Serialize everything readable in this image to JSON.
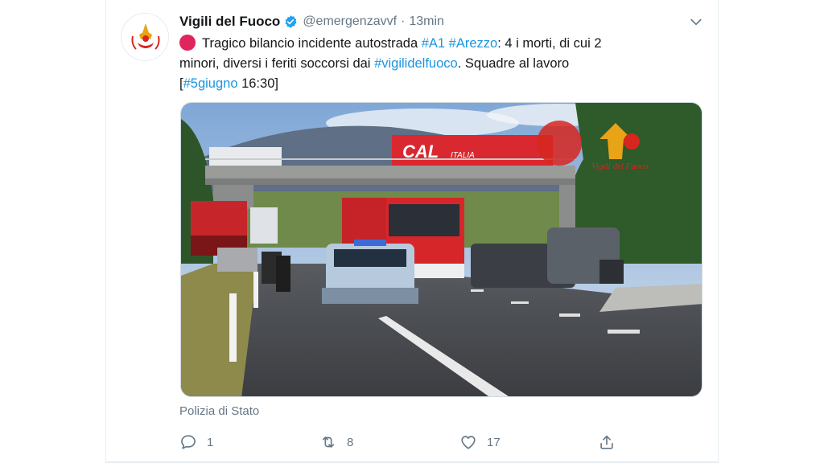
{
  "tweet": {
    "display_name": "Vigili del Fuoco",
    "handle": "@emergenzavvf",
    "separator": "·",
    "time": "13min",
    "text": {
      "l1_a": "Tragico bilancio incidente autostrada ",
      "tag_a1": "#A1",
      "tag_arezzo": "#Arezzo",
      "l1_b": ": 4 i morti, di cui 2",
      "l2_a": "minori, diversi i feriti soccorsi dai ",
      "tag_vigili": "#vigilidelfuoco",
      "l2_b": ". Squadre al lavoro",
      "l3_open": "[",
      "tag_date": "#5giugno",
      "l3_close": " 16:30]"
    },
    "media": {
      "truck_lettering": "CAL",
      "truck_lettering_sub": "ITALIA",
      "watermark": "Vigili del Fuoco"
    },
    "media_credit": "Polizia di Stato",
    "actions": {
      "reply_count": "1",
      "retweet_count": "8",
      "like_count": "17"
    },
    "colors": {
      "link": "#1b95e0",
      "secondary_text": "#657786",
      "verified": "#1da1f2",
      "alert_dot": "#e0245e"
    },
    "icons": [
      "verified-badge-icon",
      "chevron-down-icon",
      "red-circle-emoji",
      "reply-icon",
      "retweet-icon",
      "like-icon",
      "share-icon"
    ]
  }
}
